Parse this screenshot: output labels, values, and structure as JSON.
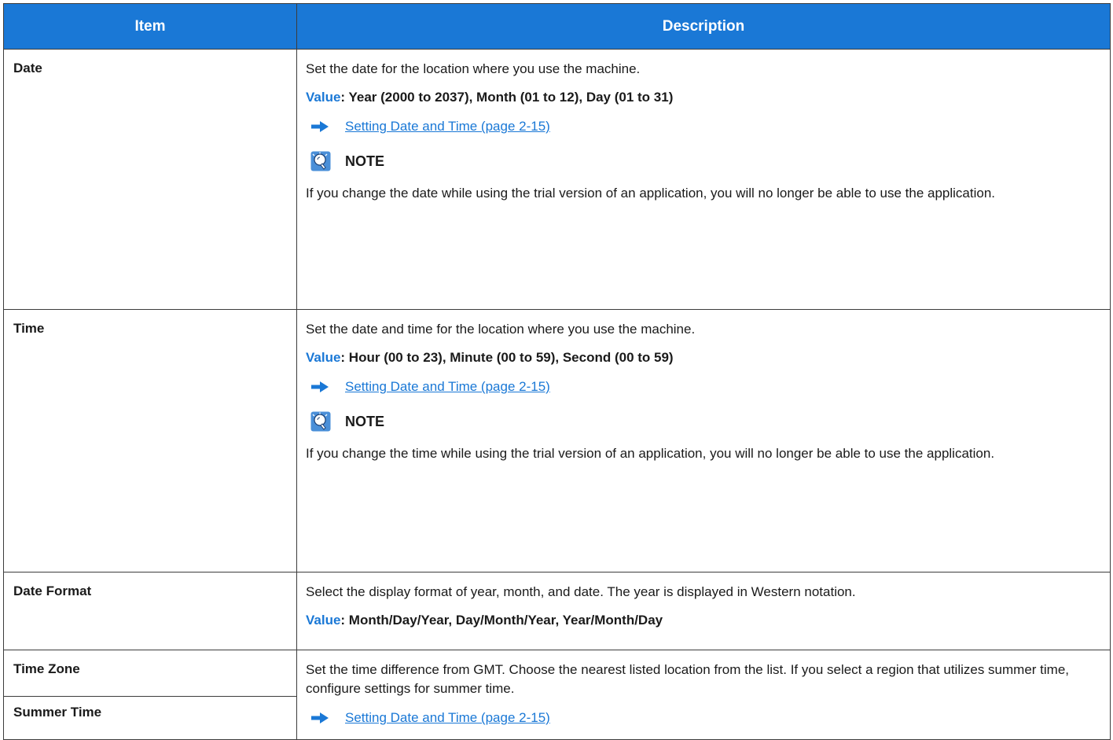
{
  "table": {
    "headers": {
      "item": "Item",
      "description": "Description"
    },
    "rows": [
      {
        "item": "Date",
        "description": "Set the date for the location where you use the machine.",
        "value_label": "Value",
        "value_text": ": Year (2000 to 2037), Month (01 to 12), Day (01 to 31)",
        "ref_link": "Setting Date and Time (page 2-15)",
        "note_title": "NOTE",
        "note_text": "If you change the date while using the trial version of an application, you will no longer be able to use the application."
      },
      {
        "item": "Time",
        "description": "Set the date and time for the location where you use the machine.",
        "value_label": "Value",
        "value_text": ": Hour (00 to 23), Minute (00 to 59), Second (00 to 59)",
        "ref_link": "Setting Date and Time (page 2-15)",
        "note_title": "NOTE",
        "note_text": "If you change the time while using the trial version of an application, you will no longer be able to use the application."
      },
      {
        "item": "Date Format",
        "description": "Select the display format of year, month, and date. The year is displayed in Western notation.",
        "value_label": "Value",
        "value_text": ": Month/Day/Year, Day/Month/Year, Year/Month/Day"
      },
      {
        "item": "Time Zone",
        "description": "Set the time difference from GMT. Choose the nearest listed location from the list. If you select a region that utilizes summer time, configure settings for summer time.",
        "ref_link": "Setting Date and Time (page 2-15)"
      },
      {
        "item": "Summer Time"
      }
    ]
  },
  "colors": {
    "accent": "#1a78d6",
    "border": "#3c3c3c",
    "text": "#1a1a1a"
  },
  "icons": {
    "reference": "arrow-right-icon",
    "note": "note-lightbulb-icon"
  }
}
